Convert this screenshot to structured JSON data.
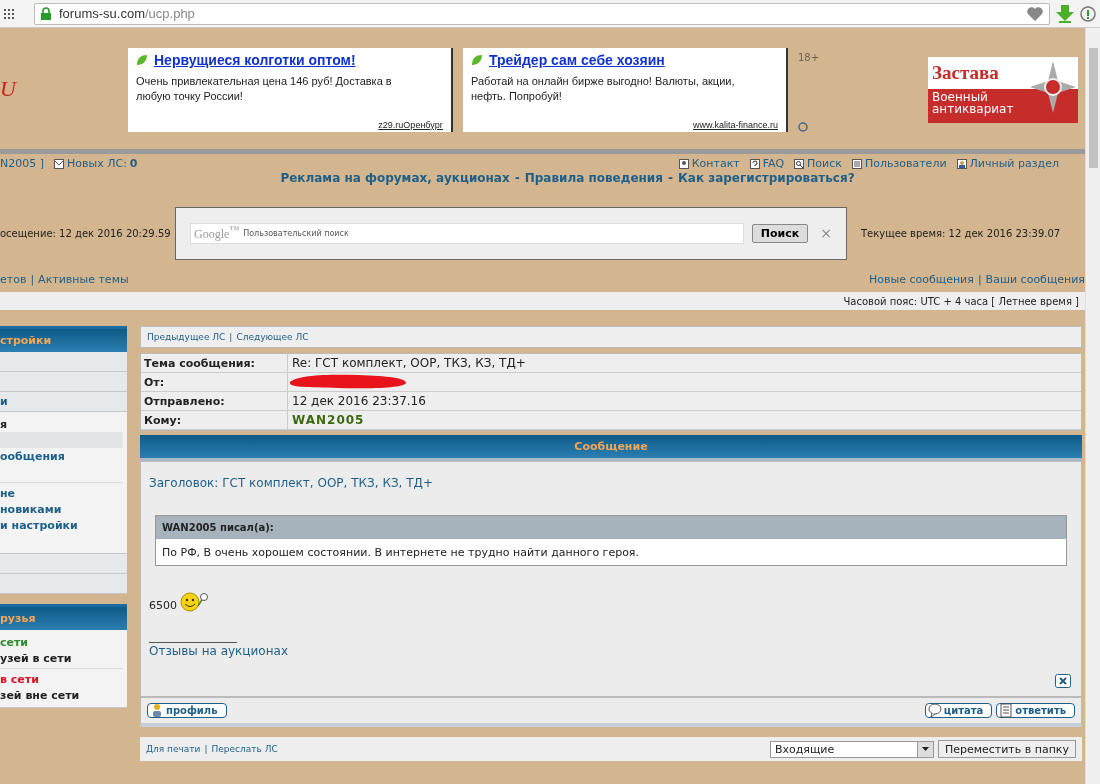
{
  "browser": {
    "url_host": "forums-su.com",
    "url_path": "/ucp.php"
  },
  "header": {
    "logo_fragment": "U",
    "ads": [
      {
        "title": "Нервущиеся колготки оптом!",
        "text": "Очень привлекательная цена 146 руб! Доставка в любую точку России!",
        "source": "z29.ruОренбург"
      },
      {
        "title": "Трейдер сам себе хозяин",
        "text": "Работай на онлайн бирже выгодно! Валюты, акции, нефть. Попробуй!",
        "source": "www.kalita-finance.ru"
      }
    ],
    "age_label": "18+",
    "banner": {
      "title": "Застава",
      "subtitle": "Военный антиквариат"
    }
  },
  "user_bar": {
    "user_fragment": "N2005 ]",
    "new_pm_label": "Новых ЛС:",
    "new_pm_count": "0",
    "links": [
      {
        "kind": "contact",
        "label": "Контакт"
      },
      {
        "kind": "faq",
        "label": "FAQ"
      },
      {
        "kind": "search",
        "label": "Поиск"
      },
      {
        "kind": "users",
        "label": "Пользователи"
      },
      {
        "kind": "profile",
        "label": "Личный раздел"
      }
    ]
  },
  "headline": {
    "links": [
      "Реклама на форумах, аукционах",
      "Правила поведения",
      "Как зарегистрироваться?"
    ],
    "separator": "-"
  },
  "search_row": {
    "last_visit": "осещение: 12 дек 2016 20:29.59",
    "brand": "Google$^{™}$",
    "placeholder": "Пользовательский поиск",
    "button": "Поиск",
    "close": "×",
    "current_time": "Текущее время: 12 дек 2016 23:39.07"
  },
  "links_row": {
    "left": [
      "етов",
      "Активные темы"
    ],
    "right": [
      "Новые сообщения",
      "Ваши сообщения"
    ],
    "separator": "|"
  },
  "timezone": "Часовой пояс: UTC + 4 часа [ Летнее время ]",
  "sidebar": [
    {
      "title": "стройки",
      "items": [
        {
          "kind": "row"
        },
        {
          "kind": "row"
        },
        {
          "kind": "row",
          "label": "и"
        },
        {
          "kind": "group",
          "children": [
            {
              "kind": "heading",
              "label": "я"
            },
            {
              "kind": "link",
              "selected": true
            },
            {
              "kind": "link",
              "label": "ообщения",
              "selected": false
            },
            {
              "kind": "gap"
            },
            {
              "kind": "rule"
            },
            {
              "kind": "link",
              "label": "не",
              "selected": false
            },
            {
              "kind": "link",
              "label": "новиками",
              "selected": false
            },
            {
              "kind": "link",
              "label": "и настройки",
              "selected": false
            },
            {
              "kind": "gap"
            }
          ]
        },
        {
          "kind": "row"
        },
        {
          "kind": "row"
        }
      ]
    },
    {
      "title": "рузья",
      "items": [
        {
          "kind": "group",
          "children": [
            {
              "kind": "status",
              "label": "сети",
              "color": "#2e8b2e"
            },
            {
              "kind": "heading",
              "label": "узей в сети"
            },
            {
              "kind": "rule"
            },
            {
              "kind": "status",
              "label": "в сети",
              "color": "#e0102a"
            },
            {
              "kind": "heading",
              "label": "зей вне сети"
            }
          ]
        }
      ]
    }
  ],
  "message": {
    "nav": {
      "prev": "Предыдущее ЛС",
      "next": "Следующее ЛС",
      "separator": "|"
    },
    "fields": [
      {
        "label": "Тема сообщения:",
        "value": "Re: ГСТ комплект, ООР, ТКЗ, КЗ, ТД+",
        "kind": "text"
      },
      {
        "label": "От:",
        "kind": "redacted"
      },
      {
        "label": "Отправлено:",
        "value": "12 дек 2016 23:37.16",
        "kind": "text"
      },
      {
        "label": "Кому:",
        "value": "WAN2005",
        "kind": "user"
      }
    ],
    "title": "Сообщение",
    "subject": "Заголовок: ГСТ комплект, ООР, ТКЗ, КЗ, ТД+",
    "quote": {
      "author": "WAN2005 писал(а):",
      "text": "По РФ, В очень хорошем состоянии. В интернете не трудно найти данного героя."
    },
    "price": "6500",
    "signature_rule": "________________",
    "signature_link": "Отзывы на аукционах",
    "buttons_left": [
      {
        "kind": "profile",
        "label": "профиль"
      }
    ],
    "buttons_right": [
      {
        "kind": "quote",
        "label": "цитата"
      },
      {
        "kind": "reply",
        "label": "ответить"
      }
    ]
  },
  "footer": {
    "links": [
      "Для печати",
      "Переслать ЛС"
    ],
    "separator": "|",
    "folder": "Входящие",
    "move_button": "Переместить в папку"
  }
}
